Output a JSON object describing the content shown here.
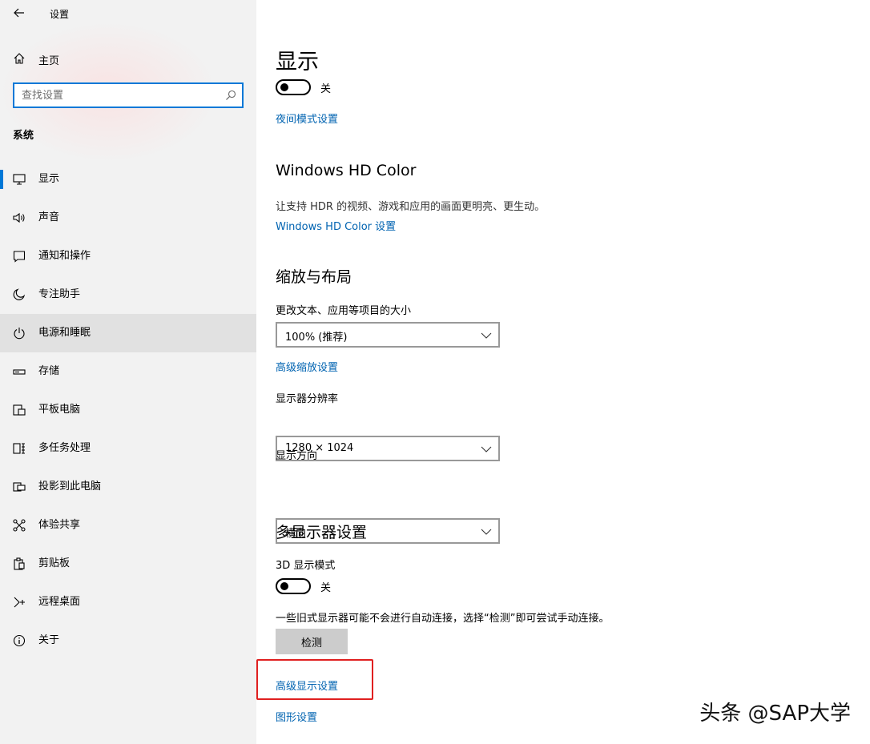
{
  "window": {
    "title": "设置"
  },
  "sidebar": {
    "home_label": "主页",
    "search_placeholder": "查找设置",
    "section_label": "系统",
    "items": [
      {
        "label": "显示",
        "icon": "monitor-icon",
        "selected": true
      },
      {
        "label": "声音",
        "icon": "speaker-icon"
      },
      {
        "label": "通知和操作",
        "icon": "notification-icon"
      },
      {
        "label": "专注助手",
        "icon": "moon-icon"
      },
      {
        "label": "电源和睡眠",
        "icon": "power-icon",
        "hover": true
      },
      {
        "label": "存储",
        "icon": "storage-icon"
      },
      {
        "label": "平板电脑",
        "icon": "tablet-icon"
      },
      {
        "label": "多任务处理",
        "icon": "multitask-icon"
      },
      {
        "label": "投影到此电脑",
        "icon": "project-icon"
      },
      {
        "label": "体验共享",
        "icon": "share-icon"
      },
      {
        "label": "剪贴板",
        "icon": "clipboard-icon"
      },
      {
        "label": "远程桌面",
        "icon": "remote-desktop-icon"
      },
      {
        "label": "关于",
        "icon": "info-icon"
      }
    ]
  },
  "main": {
    "night_light": {
      "title": "显示",
      "toggle_state": "关",
      "settings_link": "夜间模式设置"
    },
    "hd_color": {
      "title": "Windows HD Color",
      "description": "让支持 HDR 的视频、游戏和应用的画面更明亮、更生动。",
      "settings_link": "Windows HD Color 设置"
    },
    "scale_layout": {
      "title": "缩放与布局",
      "scale_label": "更改文本、应用等项目的大小",
      "scale_value": "100% (推荐)",
      "advanced_scaling_link": "高级缩放设置",
      "resolution_label": "显示器分辨率",
      "resolution_value": "1280 × 1024",
      "orientation_label": "显示方向",
      "orientation_value": "横向"
    },
    "multi_display": {
      "title": "多显示器设置",
      "mode_3d_label": "3D 显示模式",
      "mode_3d_state": "关",
      "detect_hint": "一些旧式显示器可能不会进行自动连接，选择“检测”即可尝试手动连接。",
      "detect_button": "检测",
      "advanced_display_link": "高级显示设置",
      "graphics_link": "图形设置"
    }
  },
  "watermark": "头条 @SAP大学",
  "colors": {
    "accent": "#0078d7",
    "link": "#0063b1",
    "highlight": "#e02020",
    "sidebar_bg": "#f2f2f2"
  }
}
